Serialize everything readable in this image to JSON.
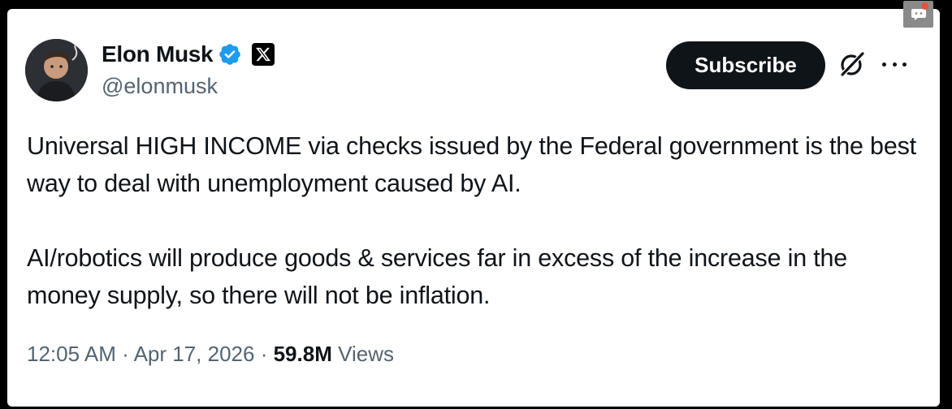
{
  "author": {
    "display_name": "Elon Musk",
    "handle": "@elonmusk",
    "verified": true,
    "affiliation_badge": "x-logo-icon",
    "avatar": "avatar-image"
  },
  "actions": {
    "subscribe_label": "Subscribe",
    "grok_icon": "grok-icon",
    "more_icon": "more-options-icon"
  },
  "tweet": {
    "paragraphs": [
      "Universal HIGH INCOME via checks issued by the Federal government is the best way to deal with unemployment caused by AI.",
      "AI/robotics will produce goods & services far in excess of the increase in the money supply, so there will not be inflation."
    ],
    "time": "12:05 AM",
    "separator": "·",
    "date": "Apr 17, 2026",
    "views_count": "59.8M",
    "views_label": "Views"
  },
  "overlay": {
    "icon": "chat-icon",
    "notification_color": "#e5533c"
  },
  "colors": {
    "verified_blue": "#1d9bf0",
    "text_primary": "#0f1419",
    "text_secondary": "#536471"
  }
}
